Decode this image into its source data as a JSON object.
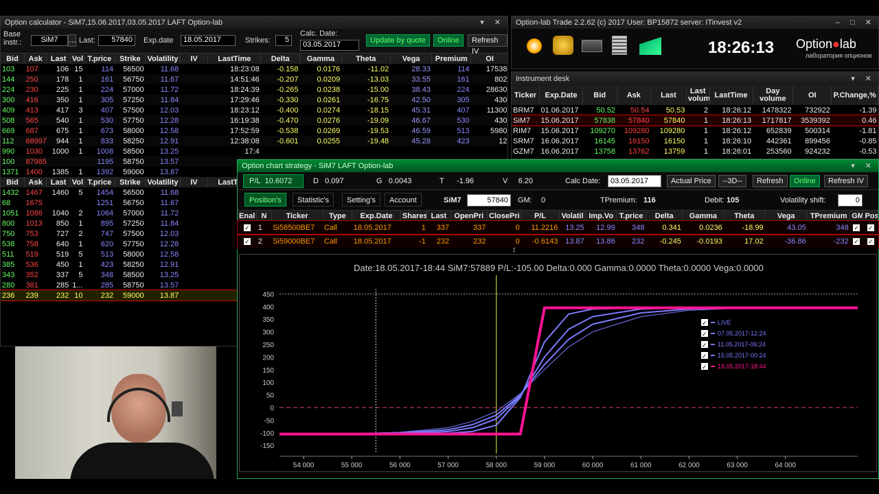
{
  "calc": {
    "title": "Option calculator - SiM7,15.06.2017,03.05.2017 LAFT Option-lab",
    "base_label": "Base instr.:",
    "base_value": "SiM7",
    "last_label": "Last:",
    "last_value": "57840",
    "exp_label": "Exp.date",
    "exp_value": "18.05.2017",
    "strikes_label": "Strikes:",
    "strikes_value": "5",
    "calc_label": "Calc. Date:",
    "calc_value": "03.05.2017",
    "update_btn": "Update by quote",
    "online_btn": "Online",
    "refresh_btn": "Refresh IV",
    "headers": [
      "Bid",
      "Ask",
      "Last",
      "Vol",
      "T.price",
      "Strike",
      "Volatility",
      "IV",
      "LastTime",
      "Delta",
      "Gamma",
      "Theta",
      "Vega",
      "Premium",
      "OI"
    ],
    "calls": [
      [
        "103",
        "107",
        "106",
        "15",
        "114",
        "56500",
        "11.68",
        "",
        "18:23:08",
        "-0.158",
        "0.0176",
        "-11.02",
        "28.33",
        "114",
        "17538"
      ],
      [
        "144",
        "250",
        "178",
        "1",
        "161",
        "56750",
        "11.67",
        "",
        "14:51:46",
        "-0.207",
        "0.0209",
        "-13.03",
        "33.55",
        "161",
        "802"
      ],
      [
        "224",
        "230",
        "225",
        "1",
        "224",
        "57000",
        "11.72",
        "",
        "18:24:39",
        "-0.265",
        "0.0238",
        "-15.00",
        "38.43",
        "224",
        "28630"
      ],
      [
        "300",
        "416",
        "350",
        "1",
        "305",
        "57250",
        "11.84",
        "",
        "17:29:46",
        "-0.330",
        "0.0261",
        "-16.75",
        "42.50",
        "305",
        "430"
      ],
      [
        "409",
        "413",
        "417",
        "3",
        "407",
        "57500",
        "12.03",
        "",
        "18:23:12",
        "-0.400",
        "0.0274",
        "-18.15",
        "45.31",
        "407",
        "11300"
      ],
      [
        "508",
        "565",
        "540",
        "1",
        "530",
        "57750",
        "12.28",
        "",
        "16:19:38",
        "-0.470",
        "0.0276",
        "-19.09",
        "46.67",
        "530",
        "430"
      ],
      [
        "669",
        "687",
        "675",
        "1",
        "673",
        "58000",
        "12.58",
        "",
        "17:52:59",
        "-0.538",
        "0.0269",
        "-19.53",
        "46.59",
        "513",
        "5980"
      ],
      [
        "112",
        "68997",
        "944",
        "1",
        "833",
        "58250",
        "12.91",
        "",
        "12:38:08",
        "-0.601",
        "0.0255",
        "-19.48",
        "45.28",
        "423",
        "12"
      ],
      [
        "990",
        "1030",
        "1000",
        "1",
        "1008",
        "58500",
        "13.25",
        "",
        "17:4",
        "",
        "",
        "",
        "",
        "",
        ""
      ],
      [
        "100",
        "87985",
        "",
        "",
        "1195",
        "58750",
        "13.57",
        "",
        "",
        "",
        "",
        "",
        "",
        "",
        ""
      ],
      [
        "1371",
        "1400",
        "1385",
        "1",
        "1392",
        "59000",
        "13.87",
        "",
        "17:0",
        "",
        "",
        "",
        "",
        "",
        ""
      ]
    ],
    "puts": [
      [
        "1432",
        "1467",
        "1460",
        "5",
        "1454",
        "56500",
        "11.68",
        "",
        "15:1"
      ],
      [
        "68",
        "1675",
        "",
        "",
        "1251",
        "56750",
        "11.67",
        "",
        ""
      ],
      [
        "1051",
        "1086",
        "1040",
        "2",
        "1064",
        "57000",
        "11.72",
        "",
        "18:0"
      ],
      [
        "800",
        "1013",
        "850",
        "1",
        "895",
        "57250",
        "11.84",
        "",
        "18:0"
      ],
      [
        "750",
        "753",
        "727",
        "2",
        "747",
        "57500",
        "12.03",
        "",
        "17:3"
      ],
      [
        "538",
        "758",
        "640",
        "1",
        "620",
        "57750",
        "12.28",
        "",
        "15:3"
      ],
      [
        "511",
        "519",
        "519",
        "5",
        "513",
        "58000",
        "12.58",
        "",
        "18:0"
      ],
      [
        "385",
        "536",
        "450",
        "1",
        "423",
        "58250",
        "12.91",
        "",
        "16:2"
      ],
      [
        "343",
        "352",
        "337",
        "5",
        "348",
        "58500",
        "13.25",
        "",
        "18:0"
      ],
      [
        "280",
        "381",
        "285",
        "1...",
        "285",
        "58750",
        "13.57",
        "",
        "17:1"
      ],
      [
        "236",
        "239",
        "232",
        "10",
        "232",
        "59000",
        "13.87",
        "",
        "18:0"
      ]
    ]
  },
  "trade": {
    "title": "Option-lab Trade 2.2.62 (c) 2017 User: BP15872 server: ITinvest v2",
    "clock": "18:26:13",
    "logo": "Option",
    "logo2": "lab",
    "logo_sub": "лаборатория опционов"
  },
  "desk": {
    "title": "Instrument desk",
    "headers": [
      "Ticker",
      "Exp.Date",
      "Bid",
      "Ask",
      "Last",
      "Last volume",
      "LastTime",
      "Day volume",
      "OI",
      "P.Change,%"
    ],
    "rows": [
      [
        "BRM7",
        "01.06.2017",
        "50.52",
        "50.54",
        "50.53",
        "2",
        "18:26:12",
        "1478322",
        "732922",
        "-1.39"
      ],
      [
        "SiM7",
        "15.06.2017",
        "57838",
        "57840",
        "57840",
        "1",
        "18:26:13",
        "1717817",
        "3539392",
        "0.46"
      ],
      [
        "RIM7",
        "15.06.2017",
        "109270",
        "109280",
        "109280",
        "1",
        "18:26:12",
        "652839",
        "500314",
        "-1.81"
      ],
      [
        "SRM7",
        "16.06.2017",
        "16145",
        "16150",
        "16150",
        "1",
        "18:26:10",
        "442361",
        "899456",
        "-0.85"
      ],
      [
        "GZM7",
        "16.06.2017",
        "13758",
        "13762",
        "13759",
        "1",
        "18:26:01",
        "253560",
        "924232",
        "-0.53"
      ]
    ]
  },
  "strategy": {
    "title": "Option chart strategy - SiM7 LAFT Option-lab",
    "pl_label": "P/L",
    "pl_value": "10.6072",
    "d_label": "D",
    "d_value": "0.097",
    "g_label": "G",
    "g_value": "0.0043",
    "t_label": "T",
    "t_value": "-1.96",
    "v_label": "V",
    "v_value": "6.20",
    "calc_label": "Calc Date:",
    "calc_value": "03.05.2017",
    "actual_btn": "Actual Price",
    "d3_btn": "--3D--",
    "refresh_btn": "Refresh",
    "online_btn": "Online",
    "refresh_iv_btn": "Refresh IV",
    "tabs": [
      "Position's",
      "Statistic's",
      "Setting's",
      "Account"
    ],
    "ticker": "SiM7",
    "price": "57840",
    "gm_label": "GM:",
    "gm_value": "0",
    "tpremium_label": "TPremium:",
    "tpremium_value": "116",
    "debit_label": "Debit:",
    "debit_value": "105",
    "volshift_label": "Volatility shift:",
    "volshift_value": "0",
    "headers": [
      "Enal",
      "N",
      "Ticker",
      "Type",
      "Exp.Date",
      "Shares",
      "Last",
      "OpenPri",
      "ClosePri",
      "P/L",
      "Volatil",
      "Imp.Vo",
      "T.price",
      "Delta",
      "Gamma",
      "Theta",
      "Vega",
      "TPremium",
      "GM",
      "Posi"
    ],
    "rows": [
      [
        "✓",
        "1",
        "Si58500BE7",
        "Call",
        "18.05.2017",
        "1",
        "337",
        "337",
        "0",
        "11.2216",
        "13.25",
        "12.99",
        "348",
        "0.341",
        "0.0236",
        "-18.99",
        "43.05",
        "348",
        "✓",
        "✓"
      ],
      [
        "✓",
        "2",
        "Si59000BE7",
        "Call",
        "18.05.2017",
        "-1",
        "232",
        "232",
        "0",
        "-0.6143",
        "13.87",
        "13.86",
        "232",
        "-0.245",
        "-0.0193",
        "17.02",
        "-36.86",
        "-232",
        "✓",
        "✓"
      ]
    ]
  },
  "chart_data": {
    "type": "line",
    "title": "Date:18.05.2017-18:44  SiM7:57889  P/L:-105.00  Delta:0.000  Gamma:0.0000  Theta:0.0000  Vega:0.0000",
    "xlabel": "",
    "ylabel": "",
    "xlim": [
      53500,
      65500
    ],
    "ylim": [
      -155,
      470
    ],
    "xticks": [
      "54 000",
      "55 000",
      "56 000",
      "57 000",
      "58 000",
      "59 000",
      "60 000",
      "61 000",
      "62 000",
      "63 000",
      "64 000"
    ],
    "yticks": [
      "450",
      "400",
      "350",
      "300",
      "250",
      "200",
      "150",
      "100",
      "50",
      "0",
      "-50",
      "-100",
      "-150"
    ],
    "legend_position": "right",
    "series": [
      {
        "name": "LIVE",
        "color": "#7b7bff",
        "x": [
          53500,
          55000,
          56000,
          57000,
          57500,
          58000,
          58500,
          59000,
          59500,
          60000,
          61000,
          62000,
          63000,
          64000,
          65500
        ],
        "y": [
          -105,
          -103,
          -98,
          -80,
          -55,
          -15,
          55,
          150,
          240,
          300,
          360,
          385,
          393,
          395,
          395
        ]
      },
      {
        "name": "07.05.2017-12:24",
        "color": "#7b7bff",
        "x": [
          53500,
          55000,
          56000,
          57000,
          57500,
          58000,
          58500,
          59000,
          59500,
          60000,
          61000,
          62000,
          63000,
          64000,
          65500
        ],
        "y": [
          -105,
          -104,
          -100,
          -88,
          -68,
          -30,
          50,
          170,
          270,
          330,
          375,
          390,
          395,
          395,
          395
        ]
      },
      {
        "name": "11.05.2017-06:24",
        "color": "#7b7bff",
        "x": [
          53500,
          55000,
          56000,
          57000,
          57500,
          58000,
          58500,
          59000,
          59500,
          60000,
          61000,
          62000,
          63000,
          64000,
          65500
        ],
        "y": [
          -105,
          -105,
          -103,
          -95,
          -80,
          -45,
          45,
          200,
          310,
          360,
          390,
          395,
          395,
          395,
          395
        ]
      },
      {
        "name": "15.05.2017-00:24",
        "color": "#7b7bff",
        "x": [
          53500,
          55000,
          56000,
          57000,
          57500,
          58000,
          58500,
          59000,
          59500,
          60000,
          61000,
          62000,
          63000,
          64000,
          65500
        ],
        "y": [
          -105,
          -105,
          -105,
          -102,
          -95,
          -70,
          40,
          260,
          370,
          390,
          395,
          395,
          395,
          395,
          395
        ]
      },
      {
        "name": "18.05.2017-18:44",
        "color": "#ff1493",
        "x": [
          53500,
          58500,
          59000,
          65500
        ],
        "y": [
          -105,
          -105,
          395,
          395
        ]
      }
    ],
    "vlines": [
      55500,
      58000
    ]
  }
}
